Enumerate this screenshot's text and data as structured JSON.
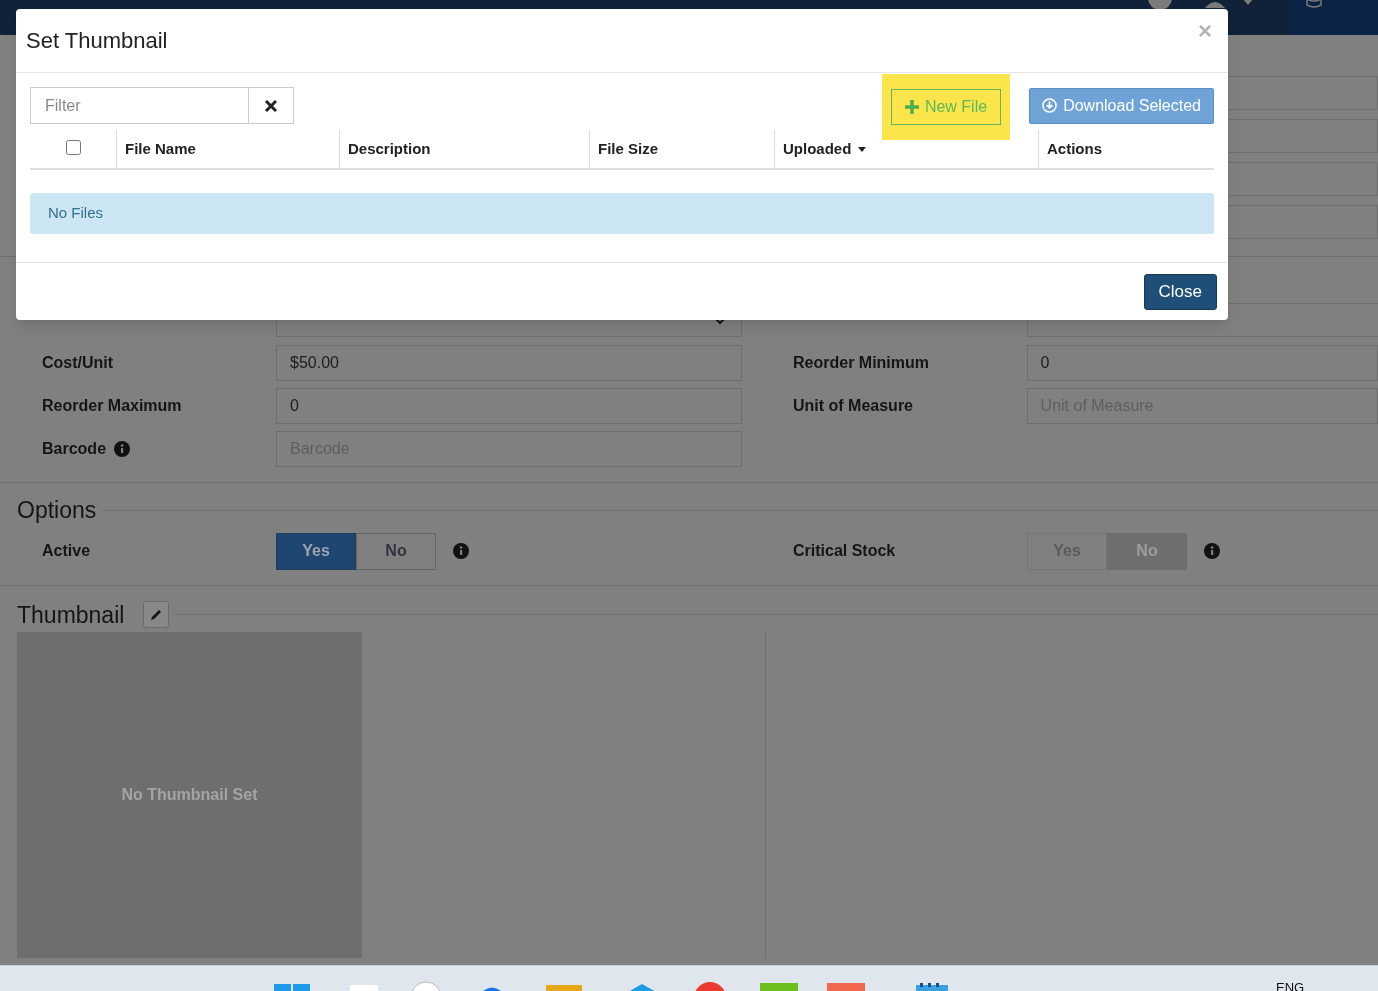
{
  "form": {
    "fields_left": [
      {
        "label": "Cost/Unit",
        "value": "$50.00"
      },
      {
        "label": "Reorder Maximum",
        "value": "0"
      },
      {
        "label": "Barcode",
        "placeholder": "Barcode",
        "info": true
      }
    ],
    "fields_right": [
      {
        "label": "Reorder Minimum",
        "value": "0"
      },
      {
        "label": "Unit of Measure",
        "placeholder": "Unit of Measure"
      }
    ]
  },
  "options": {
    "title": "Options",
    "toggles": [
      {
        "label": "Active",
        "disabled": false,
        "choices": [
          {
            "label": "Yes",
            "selected": true
          },
          {
            "label": "No",
            "selected": false
          }
        ]
      },
      {
        "label": "Critical Stock",
        "disabled": true,
        "choices": [
          {
            "label": "Yes",
            "selected": false
          },
          {
            "label": "No",
            "selected": true
          }
        ]
      }
    ]
  },
  "thumbnail": {
    "title": "Thumbnail",
    "empty_text": "No Thumbnail Set"
  },
  "modal": {
    "title": "Set Thumbnail",
    "close_glyph": "×",
    "filter": {
      "placeholder": "Filter"
    },
    "buttons": [
      {
        "label": "New File",
        "kind": "new",
        "highlighted": true
      },
      {
        "label": "Download Selected",
        "kind": "download",
        "highlighted": false
      }
    ],
    "table": {
      "select_all": {
        "checked": false
      },
      "columns": [
        {
          "label": "File Name",
          "sorted": false
        },
        {
          "label": "Description",
          "sorted": false
        },
        {
          "label": "File Size",
          "sorted": false
        },
        {
          "label": "Uploaded",
          "sorted": true
        },
        {
          "label": "Actions",
          "sorted": false
        }
      ]
    },
    "empty_text": "No Files",
    "close_button": "Close"
  },
  "taskbar": {
    "language": "ENG"
  }
}
